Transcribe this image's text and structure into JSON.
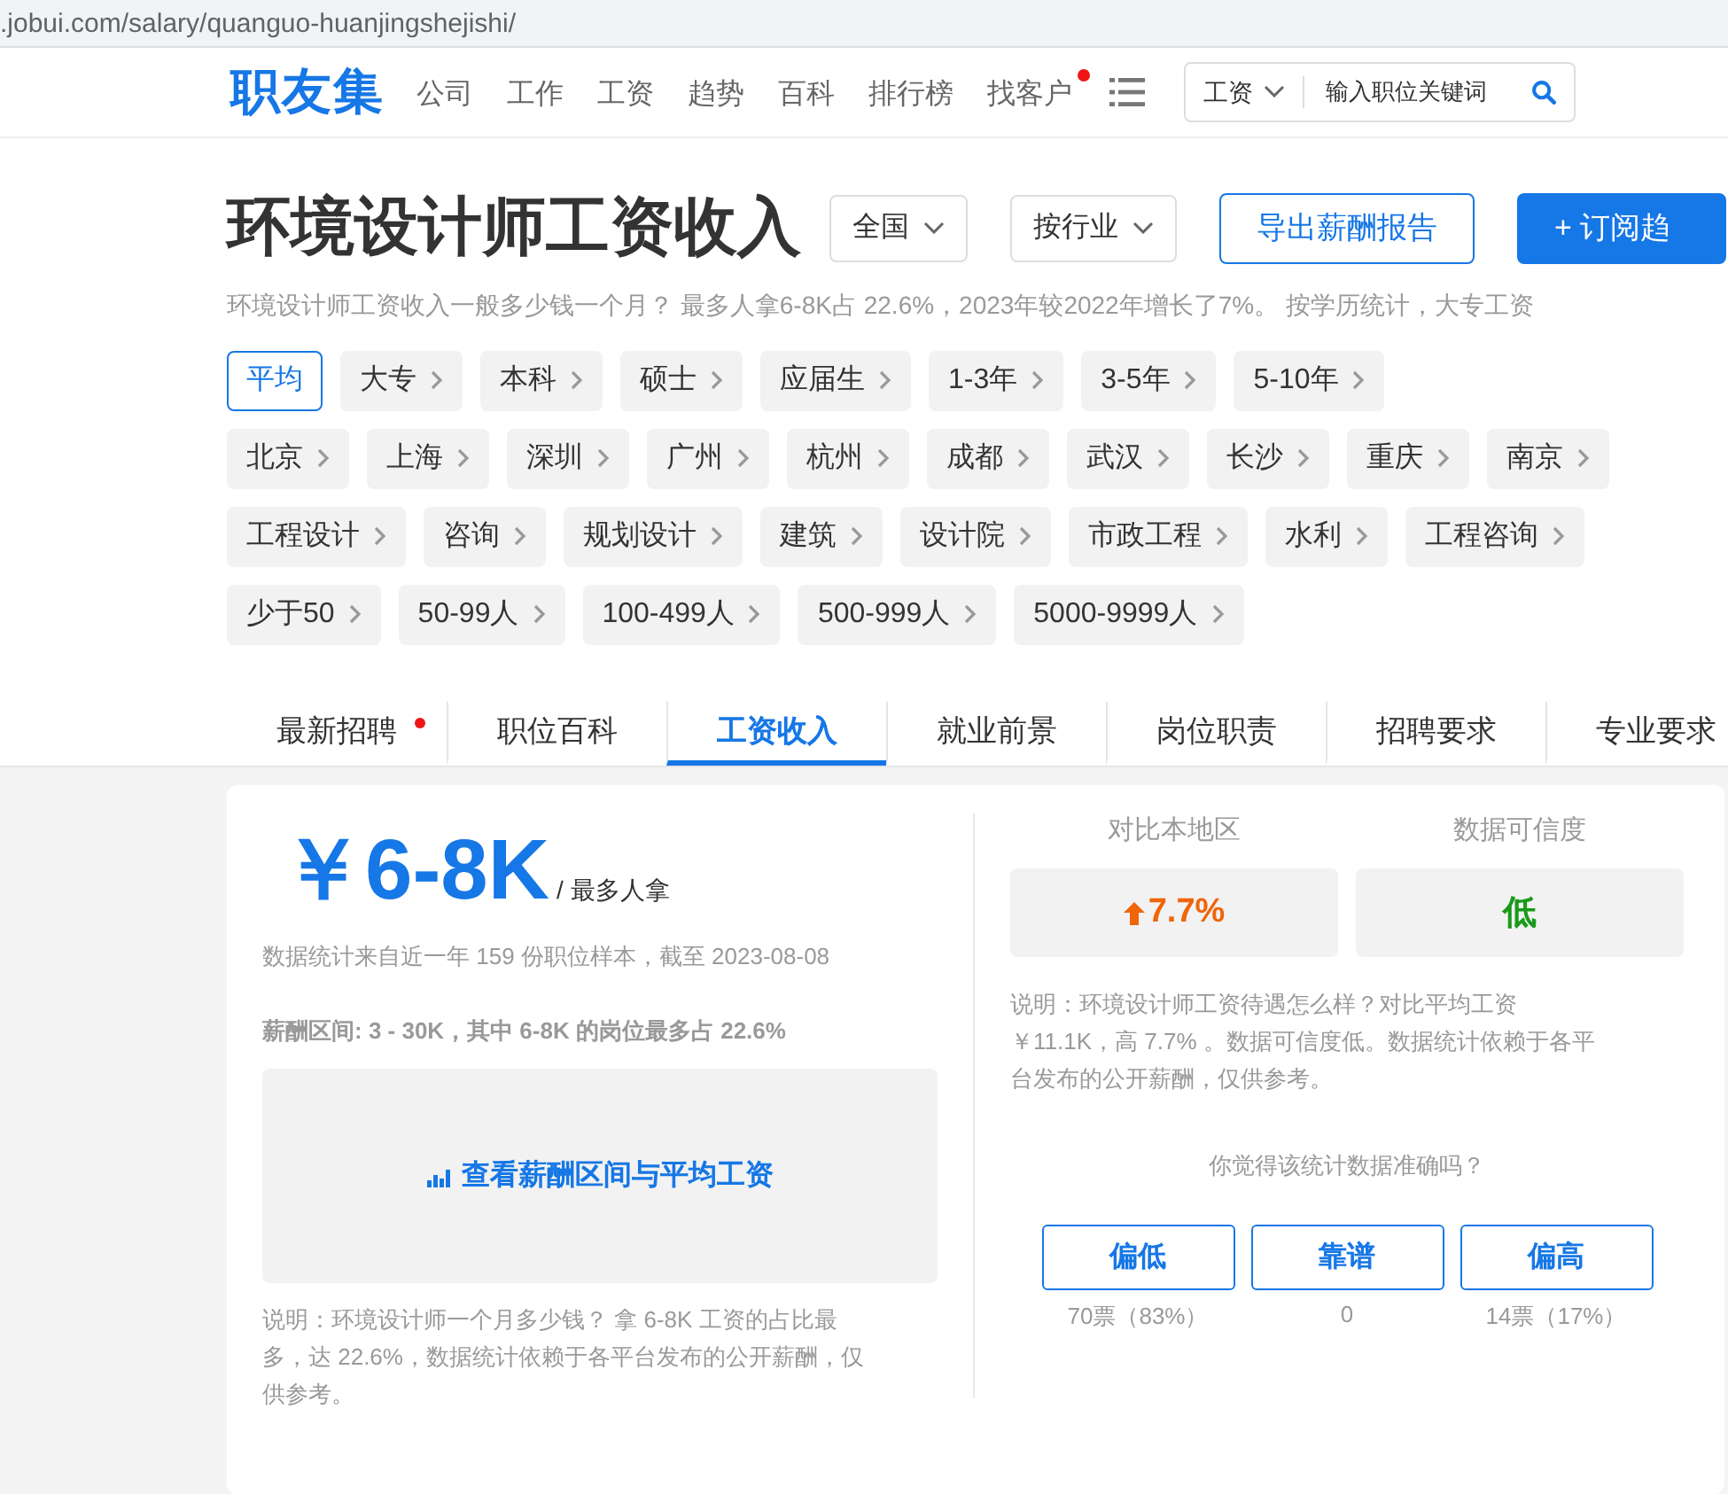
{
  "address_bar": {
    "url": ".jobui.com/salary/quanguo-huanjingshejishi/"
  },
  "header": {
    "logo": "职友集",
    "nav": [
      {
        "label": "公司",
        "badge": false
      },
      {
        "label": "工作",
        "badge": false
      },
      {
        "label": "工资",
        "badge": false
      },
      {
        "label": "趋势",
        "badge": false
      },
      {
        "label": "百科",
        "badge": false
      },
      {
        "label": "排行榜",
        "badge": false
      },
      {
        "label": "找客户",
        "badge": true
      }
    ],
    "search": {
      "category": "工资",
      "placeholder": "输入职位关键词"
    }
  },
  "title": "环境设计师工资收入",
  "filters": [
    "全国",
    "按行业"
  ],
  "actions": [
    {
      "label": "导出薪酬报告",
      "kind": "outline"
    },
    {
      "label": "+ 订阅趋",
      "kind": "solid"
    }
  ],
  "summary": "环境设计师工资收入一般多少钱一个月？ 最多人拿6-8K占 22.6%，2023年较2022年增长了7%。 按学历统计，大专工资",
  "tag_rows": [
    {
      "tags": [
        {
          "label": "平均",
          "selected": true
        },
        {
          "label": "大专",
          "selected": false
        },
        {
          "label": "本科",
          "selected": false
        },
        {
          "label": "硕士",
          "selected": false
        },
        {
          "label": "应届生",
          "selected": false
        },
        {
          "label": "1-3年",
          "selected": false
        },
        {
          "label": "3-5年",
          "selected": false
        },
        {
          "label": "5-10年",
          "selected": false
        }
      ]
    },
    {
      "tags": [
        {
          "label": "北京",
          "selected": false
        },
        {
          "label": "上海",
          "selected": false
        },
        {
          "label": "深圳",
          "selected": false
        },
        {
          "label": "广州",
          "selected": false
        },
        {
          "label": "杭州",
          "selected": false
        },
        {
          "label": "成都",
          "selected": false
        },
        {
          "label": "武汉",
          "selected": false
        },
        {
          "label": "长沙",
          "selected": false
        },
        {
          "label": "重庆",
          "selected": false
        },
        {
          "label": "南京",
          "selected": false
        }
      ]
    },
    {
      "tags": [
        {
          "label": "工程设计",
          "selected": false
        },
        {
          "label": "咨询",
          "selected": false
        },
        {
          "label": "规划设计",
          "selected": false
        },
        {
          "label": "建筑",
          "selected": false
        },
        {
          "label": "设计院",
          "selected": false
        },
        {
          "label": "市政工程",
          "selected": false
        },
        {
          "label": "水利",
          "selected": false
        },
        {
          "label": "工程咨询",
          "selected": false
        }
      ]
    },
    {
      "tags": [
        {
          "label": "少于50",
          "selected": false
        },
        {
          "label": "50-99人",
          "selected": false
        },
        {
          "label": "100-499人",
          "selected": false
        },
        {
          "label": "500-999人",
          "selected": false
        },
        {
          "label": "5000-9999人",
          "selected": false
        }
      ]
    }
  ],
  "tabs": [
    {
      "label": "最新招聘",
      "selected": false,
      "badge": true
    },
    {
      "label": "职位百科",
      "selected": false,
      "badge": false
    },
    {
      "label": "工资收入",
      "selected": true,
      "badge": false
    },
    {
      "label": "就业前景",
      "selected": false,
      "badge": false
    },
    {
      "label": "岗位职责",
      "selected": false,
      "badge": false
    },
    {
      "label": "招聘要求",
      "selected": false,
      "badge": false
    },
    {
      "label": "专业要求",
      "selected": false,
      "badge": false
    }
  ],
  "salary": {
    "amount": "￥6-8K",
    "unit": "/ 最多人拿",
    "source": "数据统计来自近一年 159 份职位样本，截至 2023-08-08",
    "range": "薪酬区间: 3 - 30K，其中 6-8K 的岗位最多占 22.6%",
    "chart_link": "查看薪酬区间与平均工资",
    "note": "说明：环境设计师一个月多少钱？ 拿 6-8K 工资的占比最多，达 22.6%，数据统计依赖于各平台发布的公开薪酬，仅供参考。"
  },
  "stats": [
    {
      "label": "对比本地区",
      "value": "7.7%",
      "kind": "up"
    },
    {
      "label": "数据可信度",
      "value": "低",
      "kind": "rating"
    }
  ],
  "stats_note": "说明：环境设计师工资待遇怎么样？对比平均工资￥11.1K，高 7.7% 。数据可信度低。数据统计依赖于各平台发布的公开薪酬，仅供参考。",
  "poll": {
    "question": "你觉得该统计数据准确吗？",
    "options": [
      {
        "label": "偏低",
        "votes": "70票（83%）"
      },
      {
        "label": "靠谱",
        "votes": "0"
      },
      {
        "label": "偏高",
        "votes": "14票（17%）"
      }
    ]
  }
}
